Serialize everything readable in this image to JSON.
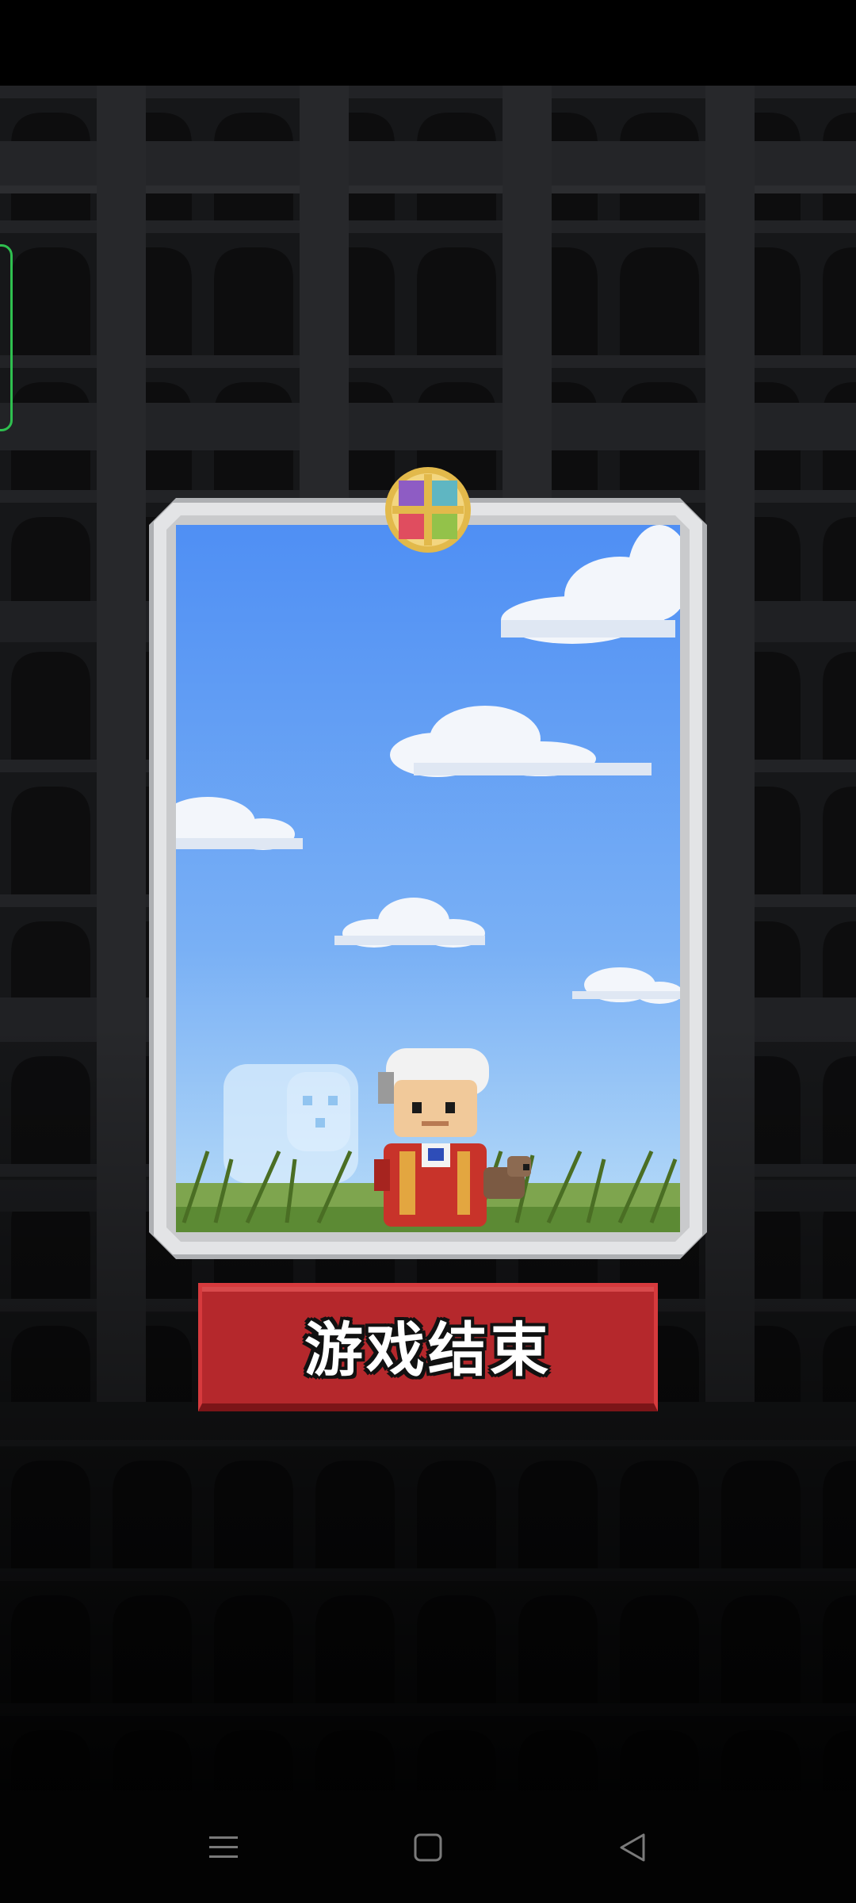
{
  "dialog": {
    "button_label": "游戏结束"
  },
  "card": {
    "character": "elder-in-red-robe-icon",
    "companion": "dog-icon",
    "ghost": "ghost-icon",
    "emblem": "four-color-emblem-icon"
  },
  "navigation": {
    "menu": "menu-icon",
    "home": "home-icon",
    "back": "back-icon"
  },
  "colors": {
    "background": "#050505",
    "tower_dark": "#1a1b1d",
    "sky_top": "#4f8ff4",
    "sky_bottom": "#b8dcf8",
    "frame": "#d5d6d8",
    "button": "#b5282c",
    "edge_panel": "#2fbf4f"
  }
}
